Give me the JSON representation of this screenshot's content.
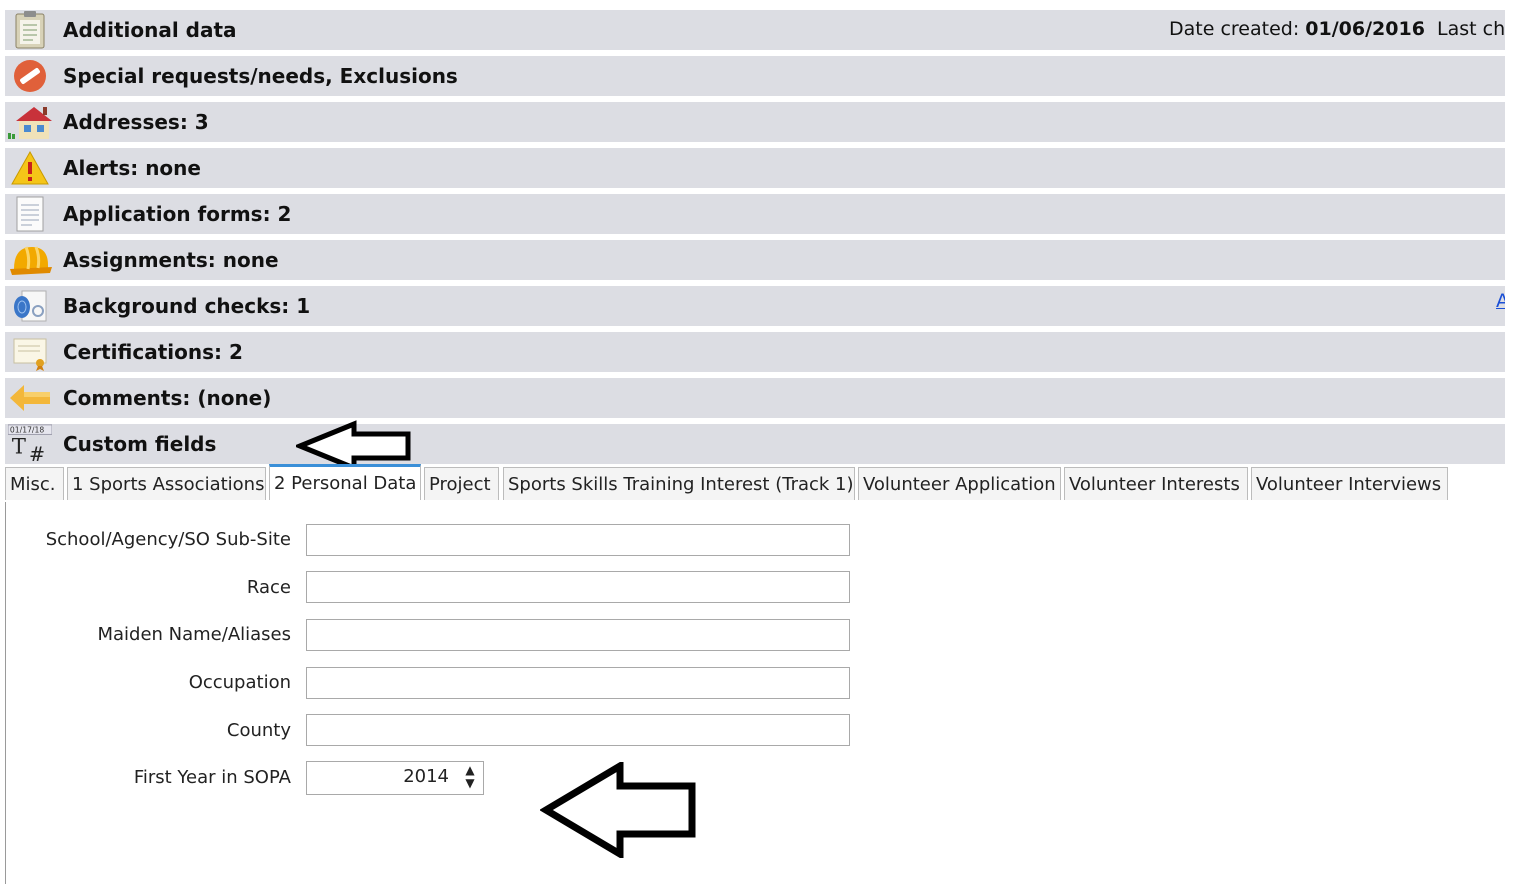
{
  "sections": [
    {
      "label": "Additional data",
      "icon": "clipboard-icon"
    },
    {
      "label": "Special requests/needs, Exclusions",
      "icon": "no-entry-icon"
    },
    {
      "label": "Addresses: 3",
      "icon": "house-icon"
    },
    {
      "label": "Alerts: none",
      "icon": "warning-icon"
    },
    {
      "label": "Application forms: 2",
      "icon": "document-icon"
    },
    {
      "label": "Assignments: none",
      "icon": "hard-hat-icon"
    },
    {
      "label": "Background checks: 1",
      "icon": "fingerprint-icon"
    },
    {
      "label": "Certifications: 2",
      "icon": "certificate-icon"
    },
    {
      "label": "Comments: (none)",
      "icon": "comment-arrow-icon"
    },
    {
      "label": "Custom fields",
      "icon": "custom-fields-icon"
    }
  ],
  "header_meta": {
    "date_created_label": "Date created:",
    "date_created_value": "01/06/2016",
    "last_changed_label": "Last cha"
  },
  "background_link": "A",
  "custom_fields_icon_text": {
    "date": "01/17/18",
    "t": "T",
    "hash": "#"
  },
  "tabs": [
    {
      "label": "Misc.",
      "active": false
    },
    {
      "label": "1 Sports Associations",
      "active": false
    },
    {
      "label": "2 Personal Data",
      "active": true
    },
    {
      "label": "Project",
      "active": false
    },
    {
      "label": "Sports Skills Training Interest (Track 1)",
      "active": false
    },
    {
      "label": "Volunteer Application",
      "active": false
    },
    {
      "label": "Volunteer Interests",
      "active": false
    },
    {
      "label": "Volunteer Interviews",
      "active": false
    }
  ],
  "fields": [
    {
      "label": "School/Agency/SO Sub-Site",
      "value": ""
    },
    {
      "label": "Race",
      "value": ""
    },
    {
      "label": "Maiden Name/Aliases",
      "value": ""
    },
    {
      "label": "Occupation",
      "value": ""
    },
    {
      "label": "County",
      "value": ""
    }
  ],
  "first_year": {
    "label": "First Year in SOPA",
    "value": "2014"
  },
  "colors": {
    "row_bg": "#dcdde3",
    "active_tab_accent": "#3a8fd8",
    "link": "#1a4fd6"
  }
}
